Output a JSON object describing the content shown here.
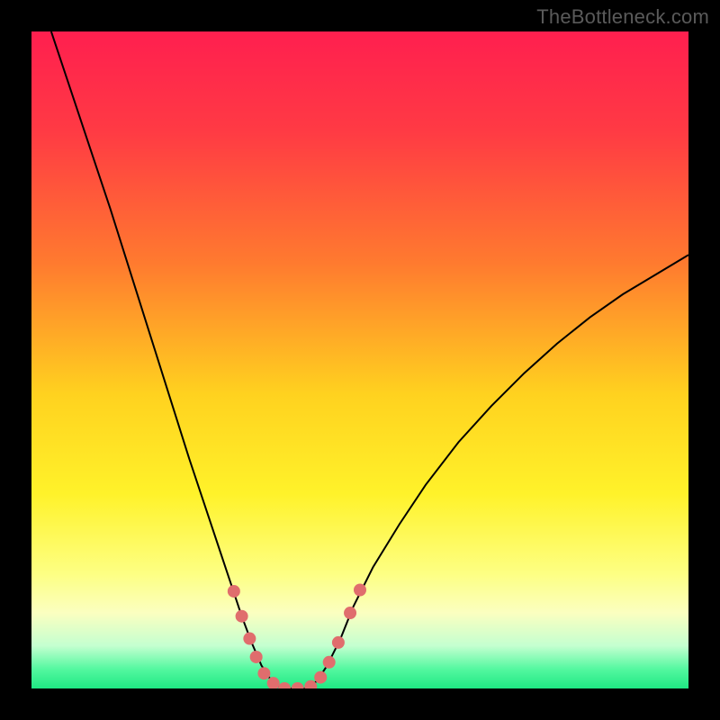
{
  "watermark": "TheBottleneck.com",
  "chart_data": {
    "type": "line",
    "title": "",
    "xlabel": "",
    "ylabel": "",
    "xlim": [
      0,
      100
    ],
    "ylim": [
      0,
      100
    ],
    "background_gradient_stops": [
      {
        "t": 0.0,
        "color": "#ff1f4f"
      },
      {
        "t": 0.15,
        "color": "#ff3a44"
      },
      {
        "t": 0.35,
        "color": "#ff7a2f"
      },
      {
        "t": 0.55,
        "color": "#ffd21f"
      },
      {
        "t": 0.7,
        "color": "#fff22a"
      },
      {
        "t": 0.82,
        "color": "#fdff82"
      },
      {
        "t": 0.88,
        "color": "#fbffc0"
      },
      {
        "t": 0.93,
        "color": "#c4ffd0"
      },
      {
        "t": 0.965,
        "color": "#54f8a0"
      },
      {
        "t": 1.0,
        "color": "#15e57e"
      }
    ],
    "series": [
      {
        "name": "bottleneck-curve",
        "stroke": "#000000",
        "stroke_width": 2,
        "points": [
          {
            "x": 3.0,
            "y": 100.0
          },
          {
            "x": 6.0,
            "y": 91.0
          },
          {
            "x": 9.0,
            "y": 82.0
          },
          {
            "x": 12.0,
            "y": 73.0
          },
          {
            "x": 15.0,
            "y": 63.5
          },
          {
            "x": 18.0,
            "y": 54.0
          },
          {
            "x": 21.0,
            "y": 44.5
          },
          {
            "x": 24.0,
            "y": 35.0
          },
          {
            "x": 27.0,
            "y": 26.0
          },
          {
            "x": 29.0,
            "y": 20.0
          },
          {
            "x": 30.5,
            "y": 15.5
          },
          {
            "x": 32.0,
            "y": 11.0
          },
          {
            "x": 33.5,
            "y": 7.0
          },
          {
            "x": 35.0,
            "y": 3.5
          },
          {
            "x": 36.5,
            "y": 1.2
          },
          {
            "x": 38.0,
            "y": 0.0
          },
          {
            "x": 40.0,
            "y": 0.0
          },
          {
            "x": 42.0,
            "y": 0.0
          },
          {
            "x": 43.5,
            "y": 1.2
          },
          {
            "x": 45.0,
            "y": 3.5
          },
          {
            "x": 47.0,
            "y": 7.5
          },
          {
            "x": 49.0,
            "y": 12.5
          },
          {
            "x": 52.0,
            "y": 18.5
          },
          {
            "x": 56.0,
            "y": 25.0
          },
          {
            "x": 60.0,
            "y": 31.0
          },
          {
            "x": 65.0,
            "y": 37.5
          },
          {
            "x": 70.0,
            "y": 43.0
          },
          {
            "x": 75.0,
            "y": 48.0
          },
          {
            "x": 80.0,
            "y": 52.5
          },
          {
            "x": 85.0,
            "y": 56.5
          },
          {
            "x": 90.0,
            "y": 60.0
          },
          {
            "x": 95.0,
            "y": 63.0
          },
          {
            "x": 100.0,
            "y": 66.0
          }
        ]
      }
    ],
    "markers": {
      "name": "highlighted-points",
      "color": "#e06d6d",
      "radius": 7,
      "points": [
        {
          "x": 30.8,
          "y": 14.8
        },
        {
          "x": 32.0,
          "y": 11.0
        },
        {
          "x": 33.2,
          "y": 7.6
        },
        {
          "x": 34.2,
          "y": 4.8
        },
        {
          "x": 35.4,
          "y": 2.3
        },
        {
          "x": 36.8,
          "y": 0.8
        },
        {
          "x": 38.5,
          "y": 0.0
        },
        {
          "x": 40.5,
          "y": 0.0
        },
        {
          "x": 42.5,
          "y": 0.3
        },
        {
          "x": 44.0,
          "y": 1.7
        },
        {
          "x": 45.3,
          "y": 4.0
        },
        {
          "x": 46.7,
          "y": 7.0
        },
        {
          "x": 48.5,
          "y": 11.5
        },
        {
          "x": 50.0,
          "y": 15.0
        }
      ]
    }
  }
}
